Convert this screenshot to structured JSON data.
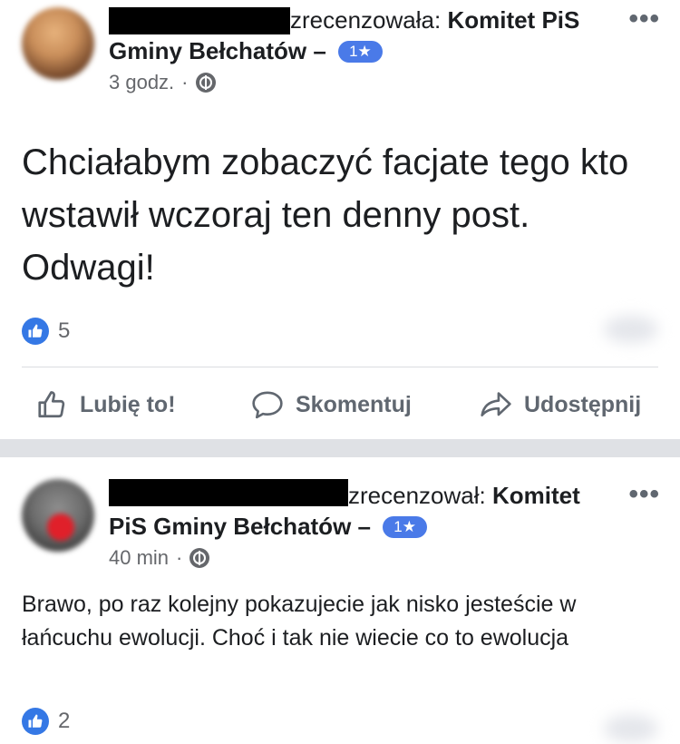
{
  "posts": [
    {
      "reviewed_text": "zrecenzowała:",
      "page_name_part1": "Komitet PiS",
      "page_name_part2": "Gminy Bełchatów",
      "dash": "–",
      "rating_badge": "1★",
      "time": "3 godz.",
      "dot_sep": "·",
      "text": "Chciałabym zobaczyć facjate tego kto wstawił wczoraj ten denny post. Odwagi!",
      "reaction_count": "5",
      "actions": {
        "like": "Lubię to!",
        "comment": "Skomentuj",
        "share": "Udostępnij"
      },
      "more_icon": "more-icon"
    },
    {
      "reviewed_text": "zrecenzował:",
      "page_name_part1": "Komitet",
      "page_name_part2": "PiS Gminy Bełchatów",
      "dash": "–",
      "rating_badge": "1★",
      "time": "40 min",
      "dot_sep": "·",
      "text": "Brawo, po raz kolejny pokazujecie jak nisko jesteście w łańcuchu ewolucji. Choć i tak nie wiecie co to ewolucja",
      "reaction_count": "2",
      "more_icon": "more-icon"
    }
  ],
  "colors": {
    "facebook_blue": "#3578e5",
    "rating_badge": "#4a7ae8",
    "secondary_text": "#65676b",
    "separator": "#dfe1e5"
  }
}
